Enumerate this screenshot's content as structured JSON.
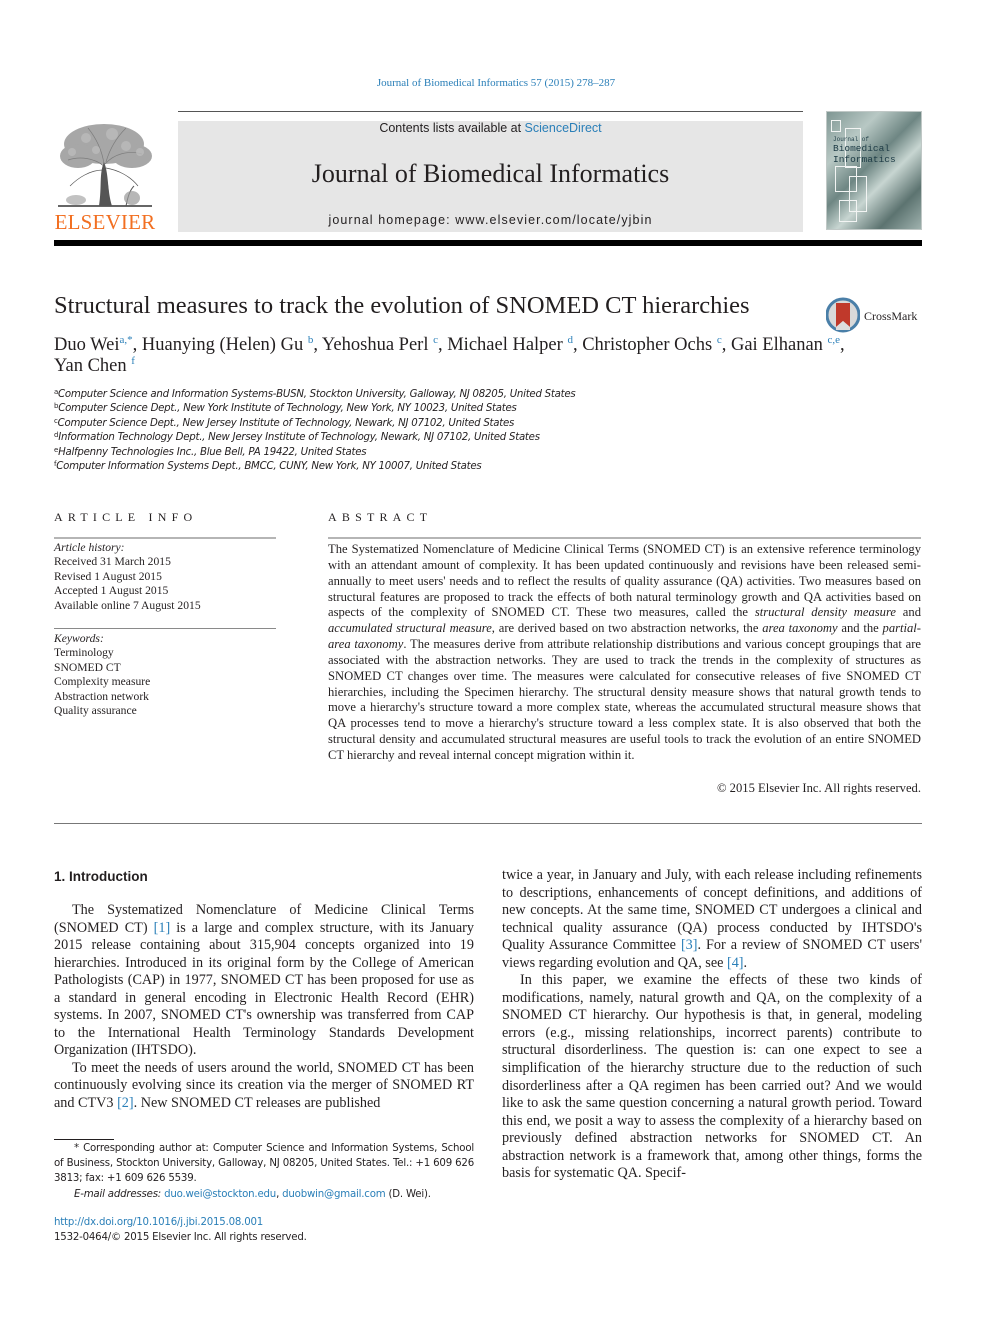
{
  "header": {
    "citation": "Journal of Biomedical Informatics 57 (2015) 278–287",
    "contents_prefix": "Contents lists available at ",
    "contents_link": "ScienceDirect",
    "journal_title": "Journal of Biomedical Informatics",
    "homepage_prefix": "journal homepage: ",
    "homepage_url": "www.elsevier.com/locate/yjbin",
    "publisher_logo": "ELSEVIER",
    "cover_title_line1": "Journal of",
    "cover_title_line2": "Biomedical",
    "cover_title_line3": "Informatics",
    "colors": {
      "link": "#2a7fb8",
      "elsevier_orange": "#f26f21",
      "masthead_bg": "#e6e6e6"
    }
  },
  "article": {
    "title": "Structural measures to track the evolution of SNOMED CT hierarchies",
    "crossmark_label": "CrossMark",
    "authors": [
      {
        "name": "Duo Wei",
        "sup": "a,*"
      },
      {
        "name": "Huanying (Helen) Gu",
        "sup": "b"
      },
      {
        "name": "Yehoshua Perl",
        "sup": "c"
      },
      {
        "name": "Michael Halper",
        "sup": "d"
      },
      {
        "name": "Christopher Ochs",
        "sup": "c"
      },
      {
        "name": "Gai Elhanan",
        "sup": "c,e"
      },
      {
        "name": "Yan Chen",
        "sup": "f"
      }
    ],
    "affiliations": [
      {
        "key": "a",
        "text": "Computer Science and Information Systems-BUSN, Stockton University, Galloway, NJ 08205, United States"
      },
      {
        "key": "b",
        "text": "Computer Science Dept., New York Institute of Technology, New York, NY 10023, United States"
      },
      {
        "key": "c",
        "text": "Computer Science Dept., New Jersey Institute of Technology, Newark, NJ 07102, United States"
      },
      {
        "key": "d",
        "text": "Information Technology Dept., New Jersey Institute of Technology, Newark, NJ 07102, United States"
      },
      {
        "key": "e",
        "text": "Halfpenny Technologies Inc., Blue Bell, PA 19422, United States"
      },
      {
        "key": "f",
        "text": "Computer Information Systems Dept., BMCC, CUNY, New York, NY 10007, United States"
      }
    ]
  },
  "article_info": {
    "heading": "ARTICLE INFO",
    "history_label": "Article history:",
    "history": [
      "Received 31 March 2015",
      "Revised 1 August 2015",
      "Accepted 1 August 2015",
      "Available online 7 August 2015"
    ],
    "keywords_label": "Keywords:",
    "keywords": [
      "Terminology",
      "SNOMED CT",
      "Complexity measure",
      "Abstraction network",
      "Quality assurance"
    ]
  },
  "abstract": {
    "heading": "ABSTRACT",
    "part1": "The Systematized Nomenclature of Medicine Clinical Terms (SNOMED CT) is an extensive reference terminology with an attendant amount of complexity. It has been updated continuously and revisions have been released semi-annually to meet users' needs and to reflect the results of quality assurance (QA) activities. Two measures based on structural features are proposed to track the effects of both natural terminology growth and QA activities based on aspects of the complexity of SNOMED CT. These two measures, called the ",
    "em1": "structural density measure",
    "part2": " and ",
    "em2": "accumulated structural measure",
    "part3": ", are derived based on two abstraction networks, the ",
    "em3": "area taxonomy",
    "part4": " and the ",
    "em4": "partial-area taxonomy",
    "part5": ". The measures derive from attribute relationship distributions and various concept groupings that are associated with the abstraction networks. They are used to track the trends in the complexity of structures as SNOMED CT changes over time. The measures were calculated for consecutive releases of five SNOMED CT hierarchies, including the Specimen hierarchy. The structural density measure shows that natural growth tends to move a hierarchy's structure toward a more complex state, whereas the accumulated structural measure shows that QA processes tend to move a hierarchy's structure toward a less complex state. It is also observed that both the structural density and accumulated structural measures are useful tools to track the evolution of an entire SNOMED CT hierarchy and reveal internal concept migration within it.",
    "copyright": "© 2015 Elsevier Inc. All rights reserved."
  },
  "body": {
    "section_heading": "1. Introduction",
    "left_p1_a": "The Systematized Nomenclature of Medicine Clinical Terms (SNOMED CT) ",
    "left_p1_ref": "[1]",
    "left_p1_b": " is a large and complex structure, with its January 2015 release containing about 315,904 concepts organized into 19 hierarchies. Introduced in its original form by the College of American Pathologists (CAP) in 1977, SNOMED CT has been proposed for use as a standard in general encoding in Electronic Health Record (EHR) systems. In 2007, SNOMED CT's ownership was transferred from CAP to the International Health Terminology Standards Development Organization (IHTSDO).",
    "left_p2_a": "To meet the needs of users around the world, SNOMED CT has been continuously evolving since its creation via the merger of SNOMED RT and CTV3 ",
    "left_p2_ref": "[2]",
    "left_p2_b": ". New SNOMED CT releases are published",
    "right_p1_a": "twice a year, in January and July, with each release including refinements to descriptions, enhancements of concept definitions, and additions of new concepts. At the same time, SNOMED CT undergoes a clinical and technical quality assurance (QA) process conducted by IHTSDO's Quality Assurance Committee ",
    "right_p1_ref1": "[3]",
    "right_p1_b": ". For a review of SNOMED CT users' views regarding evolution and QA, see ",
    "right_p1_ref2": "[4]",
    "right_p1_c": ".",
    "right_p2": "In this paper, we examine the effects of these two kinds of modifications, namely, natural growth and QA, on the complexity of a SNOMED CT hierarchy. Our hypothesis is that, in general, modeling errors (e.g., missing relationships, incorrect parents) contribute to structural disorderliness. The question is: can one expect to see a simplification of the hierarchy structure due to the reduction of such disorderliness after a QA regimen has been carried out? And we would like to ask the same question concerning a natural growth period. Toward this end, we posit a way to assess the complexity of a hierarchy based on previously defined abstraction networks for SNOMED CT. An abstraction network is a framework that, among other things, forms the basis for systematic QA. Specif-"
  },
  "footnotes": {
    "corresponding": "* Corresponding author at: Computer Science and Information Systems, School of Business, Stockton University, Galloway, NJ 08205, United States. Tel.: +1 609 626 3813; fax: +1 609 626 5539.",
    "email_label": "E-mail addresses: ",
    "email1": "duo.wei@stockton.edu",
    "email_sep": ", ",
    "email2": "duobwin@gmail.com",
    "email_suffix": " (D. Wei).",
    "doi": "http://dx.doi.org/10.1016/j.jbi.2015.08.001",
    "issn_line": "1532-0464/© 2015 Elsevier Inc. All rights reserved."
  }
}
